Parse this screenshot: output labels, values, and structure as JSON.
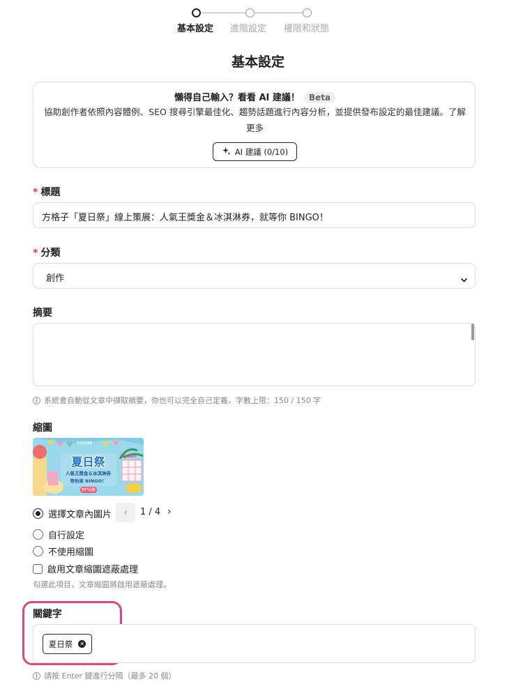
{
  "stepper": {
    "steps": [
      {
        "label": "基本設定",
        "active": true
      },
      {
        "label": "進階設定",
        "active": false
      },
      {
        "label": "權限和狀態",
        "active": false
      }
    ]
  },
  "page_title": "基本設定",
  "ai_card": {
    "heading": "懶得自己輸入？看看 AI 建議！",
    "beta_badge": "Beta",
    "description": "協助創作者依照內容體例、SEO 搜尋引擎最佳化、趨勢話題進行內容分析，並提供發布設定的最佳建議。了解更多",
    "button_label": "AI 建議 (0/10)",
    "button_icon": "sparkle-icon"
  },
  "title_field": {
    "required_mark": "*",
    "label": "標題",
    "value": "方格子「夏日祭」線上策展：人氣王獎金＆冰淇淋券，就等你 BINGO！"
  },
  "category_field": {
    "required_mark": "*",
    "label": "分類",
    "selected": "創作",
    "icon": "chevron-down-icon"
  },
  "summary_field": {
    "label": "摘要",
    "value": "",
    "hint": "系統會自動從文章中擷取摘要，你也可以完全自己定義，字數上限：150 / 150 字"
  },
  "thumbnail": {
    "label": "縮圖",
    "image_texts": {
      "brand": "vocus",
      "title": "夏日祭",
      "line1": "人氣王獎金＆冰淇淋券",
      "line2": "等你來 BINGO！",
      "corner": "BINGO",
      "footer": "熱門活動"
    },
    "options": [
      {
        "label": "選擇文章內圖片",
        "checked": true
      },
      {
        "label": "自行設定",
        "checked": false
      },
      {
        "label": "不使用縮圖",
        "checked": false
      }
    ],
    "pager": {
      "prev": "‹",
      "text": "1 / 4",
      "next": "›"
    },
    "mask_checkbox_label": "啟用文章縮圖遮蔽處理",
    "mask_checked": false,
    "mask_hint": "勾選此項目，文章縮圖將啟用遮蔽處理。"
  },
  "keywords_field": {
    "label": "關鍵字",
    "tags": [
      "夏日祭"
    ],
    "hint": "請按 Enter 鍵進行分隔（最多 20 個）"
  },
  "colors": {
    "highlight": "#d9487f",
    "required": "#e23b3b",
    "border": "#dddddd"
  }
}
